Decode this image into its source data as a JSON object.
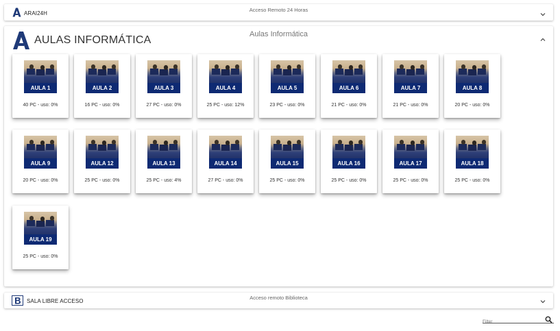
{
  "panels": {
    "arai": {
      "title": "ARAI24H",
      "subtitle": "Acceso Remoto 24 Horas"
    },
    "aulas": {
      "title": "AULAS INFORMÁTICA",
      "subtitle": "Aulas Informática"
    },
    "sala": {
      "title": "SALA LIBRE ACCESO",
      "subtitle": "Acceso remoto Biblioteca"
    }
  },
  "aulas": [
    {
      "label": "AULA 1",
      "caption": "40 PC - uso: 0%"
    },
    {
      "label": "AULA 2",
      "caption": "16 PC - uso: 0%"
    },
    {
      "label": "AULA 3",
      "caption": "27 PC - uso: 0%"
    },
    {
      "label": "AULA 4",
      "caption": "25 PC - uso: 12%"
    },
    {
      "label": "AULA 5",
      "caption": "23 PC - uso: 0%"
    },
    {
      "label": "AULA 6",
      "caption": "21 PC - uso: 0%"
    },
    {
      "label": "AULA 7",
      "caption": "21 PC - uso: 0%"
    },
    {
      "label": "AULA 8",
      "caption": "20 PC - uso: 0%"
    },
    {
      "label": "AULA 9",
      "caption": "20 PC - uso: 0%"
    },
    {
      "label": "AULA 12",
      "caption": "25 PC - uso: 0%"
    },
    {
      "label": "AULA 13",
      "caption": "25 PC - uso: 4%"
    },
    {
      "label": "AULA 14",
      "caption": "27 PC - uso: 0%"
    },
    {
      "label": "AULA 15",
      "caption": "25 PC - uso: 0%"
    },
    {
      "label": "AULA 16",
      "caption": "25 PC - uso: 0%"
    },
    {
      "label": "AULA 17",
      "caption": "25 PC - uso: 0%"
    },
    {
      "label": "AULA 18",
      "caption": "25 PC - uso: 0%"
    },
    {
      "label": "AULA 19",
      "caption": "25 PC - uso: 0%"
    }
  ],
  "filter": {
    "placeholder": "Filter"
  },
  "icons": {
    "logo_a": "letter-a-logo-icon",
    "logo_b": "letter-b-logo-icon",
    "expand": "chevron-down-icon",
    "collapse": "chevron-up-icon",
    "search": "search-icon"
  },
  "colors": {
    "brand": "#0e2a73",
    "logo": "#1f3a78"
  }
}
